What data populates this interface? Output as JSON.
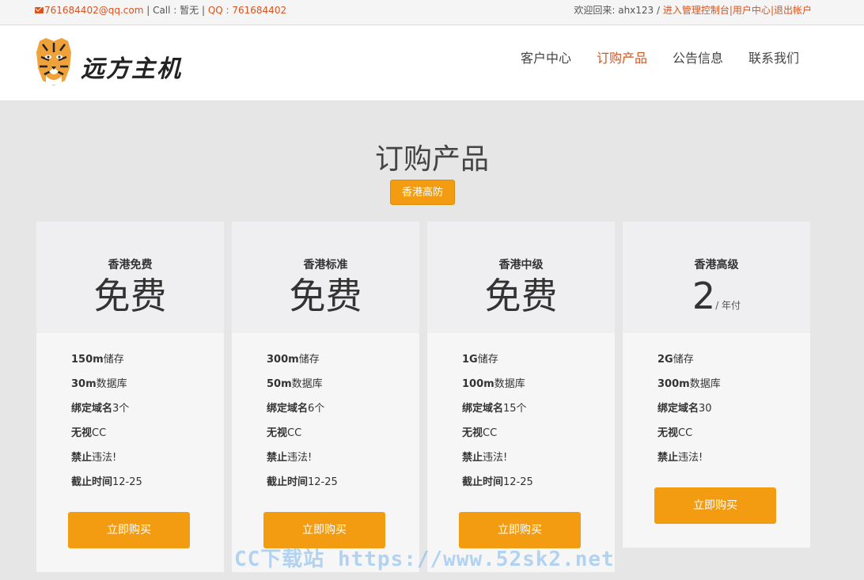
{
  "topbar": {
    "email": "761684402@qq.com",
    "sep1": " | ",
    "call": "Call : 暂无",
    "sep2": " | ",
    "qq": "QQ : 761684402",
    "welcome": "欢迎回来: ahx123 / ",
    "admin_link": "进入管理控制台",
    "sep3": "|",
    "user_link": "用户中心",
    "sep4": "|",
    "logout_link": "退出帐户"
  },
  "logo": {
    "text": "远方主机"
  },
  "nav": {
    "items": [
      {
        "label": "客户中心"
      },
      {
        "label": "订购产品"
      },
      {
        "label": "公告信息"
      },
      {
        "label": "联系我们"
      }
    ]
  },
  "page": {
    "title": "订购产品",
    "category": "香港高防"
  },
  "products": [
    {
      "name": "香港免费",
      "price": "免费",
      "unit": "",
      "features": [
        {
          "b": "150m",
          "t": "储存"
        },
        {
          "b": "30m",
          "t": "数据库"
        },
        {
          "b": "绑定域名",
          "t": "3个"
        },
        {
          "b": "无视",
          "t": "CC"
        },
        {
          "b": "禁止",
          "t": "违法!"
        },
        {
          "b": "截止时间",
          "t": "12-25"
        }
      ],
      "button": "立即购买"
    },
    {
      "name": "香港标准",
      "price": "免费",
      "unit": "",
      "features": [
        {
          "b": "300m",
          "t": "储存"
        },
        {
          "b": "50m",
          "t": "数据库"
        },
        {
          "b": "绑定域名",
          "t": "6个"
        },
        {
          "b": "无视",
          "t": "CC"
        },
        {
          "b": "禁止",
          "t": "违法!"
        },
        {
          "b": "截止时间",
          "t": "12-25"
        }
      ],
      "button": "立即购买"
    },
    {
      "name": "香港中级",
      "price": "免费",
      "unit": "",
      "features": [
        {
          "b": "1G",
          "t": "储存"
        },
        {
          "b": "100m",
          "t": "数据库"
        },
        {
          "b": "绑定域名",
          "t": "15个"
        },
        {
          "b": "无视",
          "t": "CC"
        },
        {
          "b": "禁止",
          "t": "违法!"
        },
        {
          "b": "截止时间",
          "t": "12-25"
        }
      ],
      "button": "立即购买"
    },
    {
      "name": "香港高级",
      "price": "2",
      "unit": "/ 年付",
      "features": [
        {
          "b": "2G",
          "t": "储存"
        },
        {
          "b": "300m",
          "t": "数据库"
        },
        {
          "b": "绑定域名",
          "t": "30"
        },
        {
          "b": "无视",
          "t": "CC"
        },
        {
          "b": "禁止",
          "t": "违法!"
        }
      ],
      "button": "立即购买"
    }
  ],
  "watermark": "CC下载站 https://www.52sk2.net",
  "colors": {
    "accent": "#f39c12",
    "link": "#d9531e",
    "background": "#e6e6e6"
  }
}
